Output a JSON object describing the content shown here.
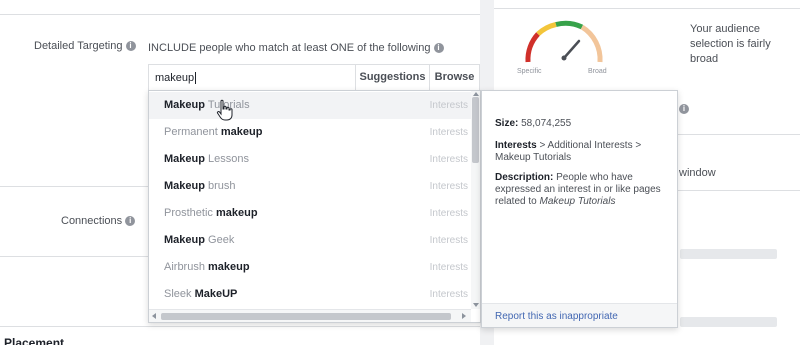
{
  "detailed_targeting": {
    "label": "Detailed Targeting",
    "include_text": "INCLUDE people who match at least ONE of the following",
    "search_value": "makeup",
    "suggestions_label": "Suggestions",
    "browse_label": "Browse"
  },
  "suggestions": [
    {
      "pre": "",
      "bold": "Makeup",
      "post": " Tutorials",
      "type": "Interests",
      "active": true
    },
    {
      "pre": "Permanent ",
      "bold": "makeup",
      "post": "",
      "type": "Interests",
      "active": false
    },
    {
      "pre": "",
      "bold": "Makeup",
      "post": " Lessons",
      "type": "Interests",
      "active": false
    },
    {
      "pre": "",
      "bold": "Makeup",
      "post": " brush",
      "type": "Interests",
      "active": false
    },
    {
      "pre": "Prosthetic ",
      "bold": "makeup",
      "post": "",
      "type": "Interests",
      "active": false
    },
    {
      "pre": "",
      "bold": "Makeup",
      "post": " Geek",
      "type": "Interests",
      "active": false
    },
    {
      "pre": "Airbrush ",
      "bold": "makeup",
      "post": "",
      "type": "Interests",
      "active": false
    },
    {
      "pre": "Sleek ",
      "bold": "MakeUP",
      "post": "",
      "type": "Interests",
      "active": false
    }
  ],
  "detail": {
    "size_label": "Size:",
    "size_value": "58,074,255",
    "path_label": "Interests",
    "path_rest": " > Additional Interests > Makeup Tutorials",
    "description_label": "Description:",
    "description_text": " People who have expressed an interest in or like pages related to ",
    "description_topic": "Makeup Tutorials",
    "report_link": "Report this as inappropriate"
  },
  "connections": {
    "label": "Connections"
  },
  "audience": {
    "specific_label": "Specific",
    "broad_label": "Broad",
    "description": "Your audience selection is fairly broad"
  },
  "right_panel": {
    "window_text": "window"
  },
  "placement": {
    "label": "Placement"
  },
  "icons": {
    "info": "i"
  },
  "colors": {
    "gauge_red": "#d0302a",
    "gauge_yellow": "#f3c53a",
    "gauge_green": "#37a24a",
    "gauge_peach": "#f2c59a",
    "link": "#4267b2"
  }
}
